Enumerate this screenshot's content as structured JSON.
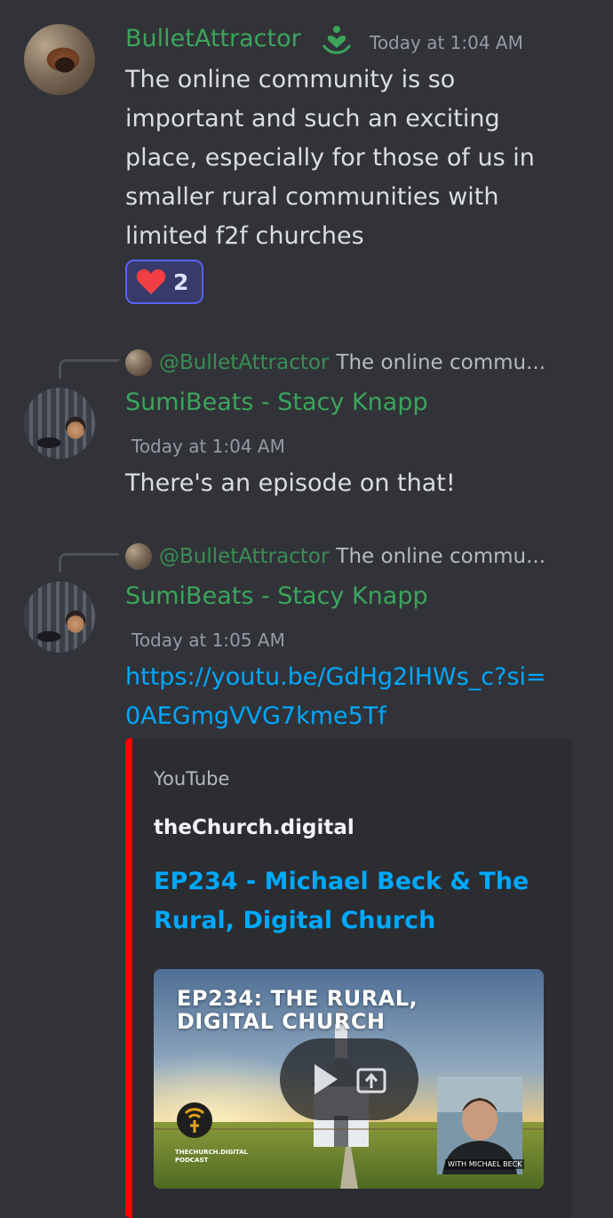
{
  "messages": [
    {
      "author": "BulletAttractor",
      "timestamp": "Today at 1:04 AM",
      "content": "The online community is so important and such an exciting place, especially for those of us in smaller rural communities with limited f2f churches",
      "reaction": {
        "emoji": "heart",
        "count": "2"
      },
      "badge_icon": "heart-hands-icon"
    },
    {
      "reply": {
        "mention": "@BulletAttractor",
        "snippet": "The online commu..."
      },
      "author": "SumiBeats - Stacy Knapp",
      "timestamp": "Today at 1:04 AM",
      "content": "There's an episode on that!"
    },
    {
      "reply": {
        "mention": "@BulletAttractor",
        "snippet": "The online commu..."
      },
      "author": "SumiBeats - Stacy Knapp",
      "timestamp": "Today at 1:05 AM",
      "link": "https://youtu.be/GdHg2lHWs_c?si=0AEGmgVVG7kme5Tf",
      "embed": {
        "provider": "YouTube",
        "author": "theChurch.digital",
        "title": "EP234 - Michael Beck & The Rural, Digital Church",
        "thumbnail_title": "EP234: THE RURAL, DIGITAL CHURCH",
        "guest_caption": "WITH MICHAEL BECK",
        "podcast_label": "THECHURCH.DIGITAL PODCAST",
        "bar_color": "#ff0000"
      }
    }
  ],
  "colors": {
    "background": "#313338",
    "username": "#3ba55c",
    "link": "#00a8fc",
    "timestamp": "#949ba4",
    "reaction_border": "#5865f2"
  }
}
